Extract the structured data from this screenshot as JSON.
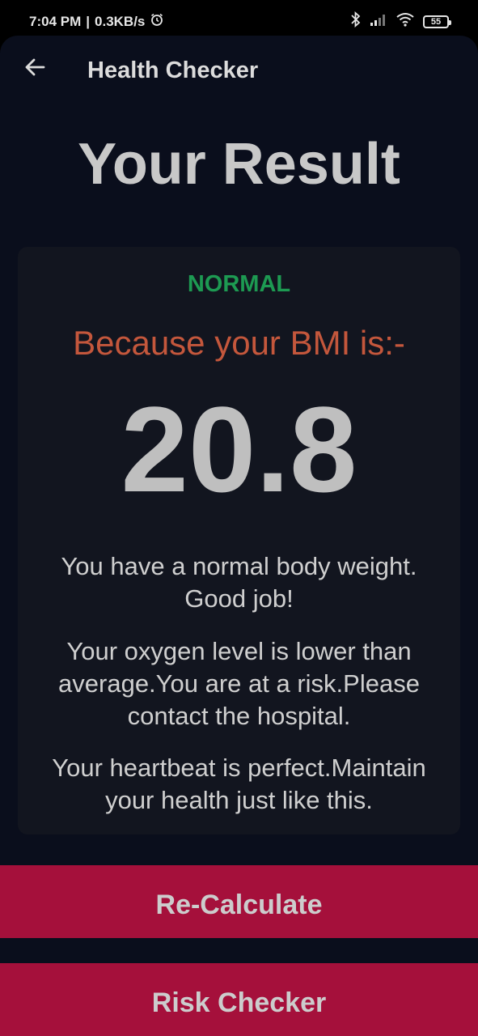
{
  "status_bar": {
    "time": "7:04 PM",
    "separator": "|",
    "speed": "0.3KB/s",
    "battery": "55"
  },
  "app_bar": {
    "title": "Health Checker"
  },
  "page": {
    "title": "Your Result"
  },
  "result": {
    "status": "NORMAL",
    "bmi_intro": "Because your BMI is:-",
    "bmi_value": "20.8",
    "weight_message": "You have a normal body weight. Good job!",
    "oxygen_message": "Your oxygen level is lower than average.You are at a risk.Please contact the hospital.",
    "heartbeat_message": "Your heartbeat is perfect.Maintain your health just like this."
  },
  "buttons": {
    "recalculate": "Re-Calculate",
    "risk_checker": "Risk Checker"
  },
  "colors": {
    "background": "#0a0e1c",
    "card": "#12151f",
    "status_normal": "#1d9a52",
    "intro_text": "#c4573c",
    "button": "#a5103b"
  }
}
